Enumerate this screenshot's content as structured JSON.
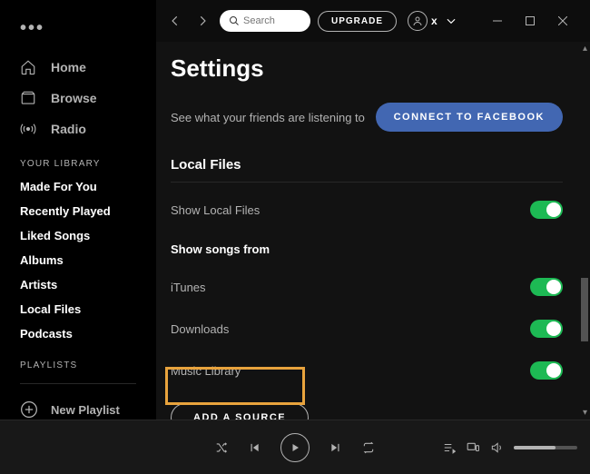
{
  "topbar": {
    "search_placeholder": "Search",
    "upgrade_label": "UPGRADE",
    "username": "x"
  },
  "sidebar": {
    "nav": [
      {
        "label": "Home"
      },
      {
        "label": "Browse"
      },
      {
        "label": "Radio"
      }
    ],
    "library_header": "YOUR LIBRARY",
    "library": [
      {
        "label": "Made For You"
      },
      {
        "label": "Recently Played"
      },
      {
        "label": "Liked Songs"
      },
      {
        "label": "Albums"
      },
      {
        "label": "Artists"
      },
      {
        "label": "Local Files"
      },
      {
        "label": "Podcasts"
      }
    ],
    "playlists_header": "PLAYLISTS",
    "new_playlist": "New Playlist"
  },
  "settings": {
    "title": "Settings",
    "social_text": "See what your friends are listening to",
    "facebook_btn": "CONNECT TO FACEBOOK",
    "local_files_title": "Local Files",
    "show_local_files": "Show Local Files",
    "show_songs_from": "Show songs from",
    "sources": [
      {
        "label": "iTunes"
      },
      {
        "label": "Downloads"
      },
      {
        "label": "Music Library"
      }
    ],
    "add_source": "ADD A SOURCE"
  }
}
